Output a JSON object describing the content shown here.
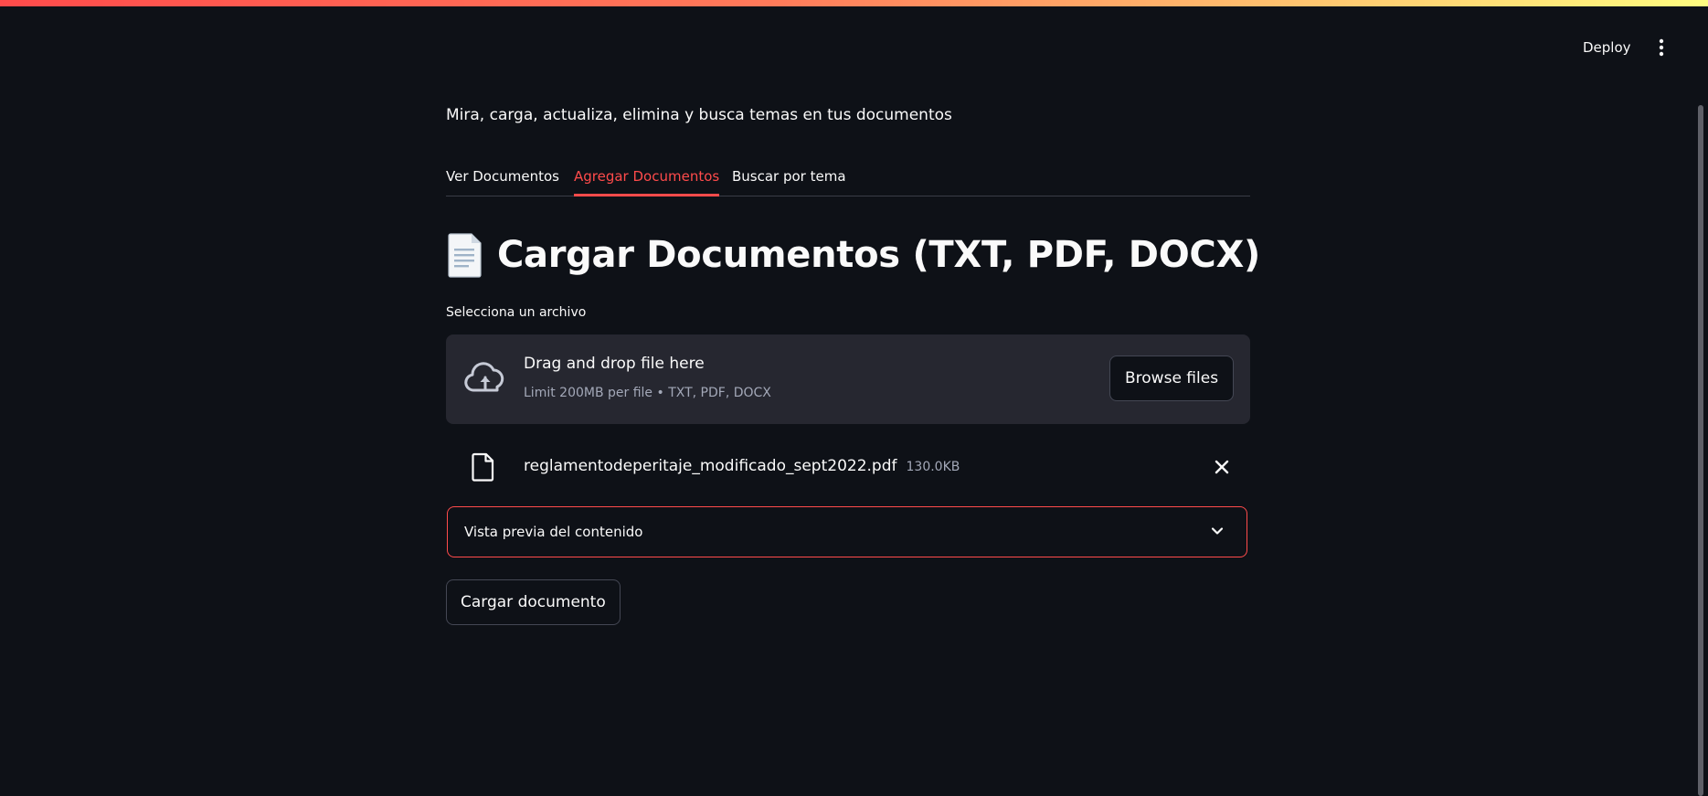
{
  "header": {
    "deploy_label": "Deploy",
    "menu_icon": "kebab-menu-icon"
  },
  "main": {
    "subtitle": "Mira, carga, actualiza, elimina y busca temas en tus documentos",
    "tabs": [
      {
        "label": "Ver Documentos",
        "active": false
      },
      {
        "label": "Agregar Documentos",
        "active": true
      },
      {
        "label": "Buscar por tema",
        "active": false
      }
    ],
    "page_title": "Cargar Documentos (TXT, PDF, DOCX)",
    "title_icon": "page-facing-up-icon",
    "uploader": {
      "label": "Selecciona un archivo",
      "drop_title": "Drag and drop file here",
      "limit": "Limit 200MB per file • TXT, PDF, DOCX",
      "browse_label": "Browse files"
    },
    "uploaded_file": {
      "name": "reglamentodeperitaje_modificado_sept2022.pdf",
      "size": "130.0KB"
    },
    "expander": {
      "label": "Vista previa del contenido",
      "expanded": false
    },
    "submit_label": "Cargar documento"
  },
  "colors": {
    "background": "#0e1117",
    "accent": "#ff4b4b",
    "surface": "#262730",
    "muted_text": "#a3a8b8"
  }
}
